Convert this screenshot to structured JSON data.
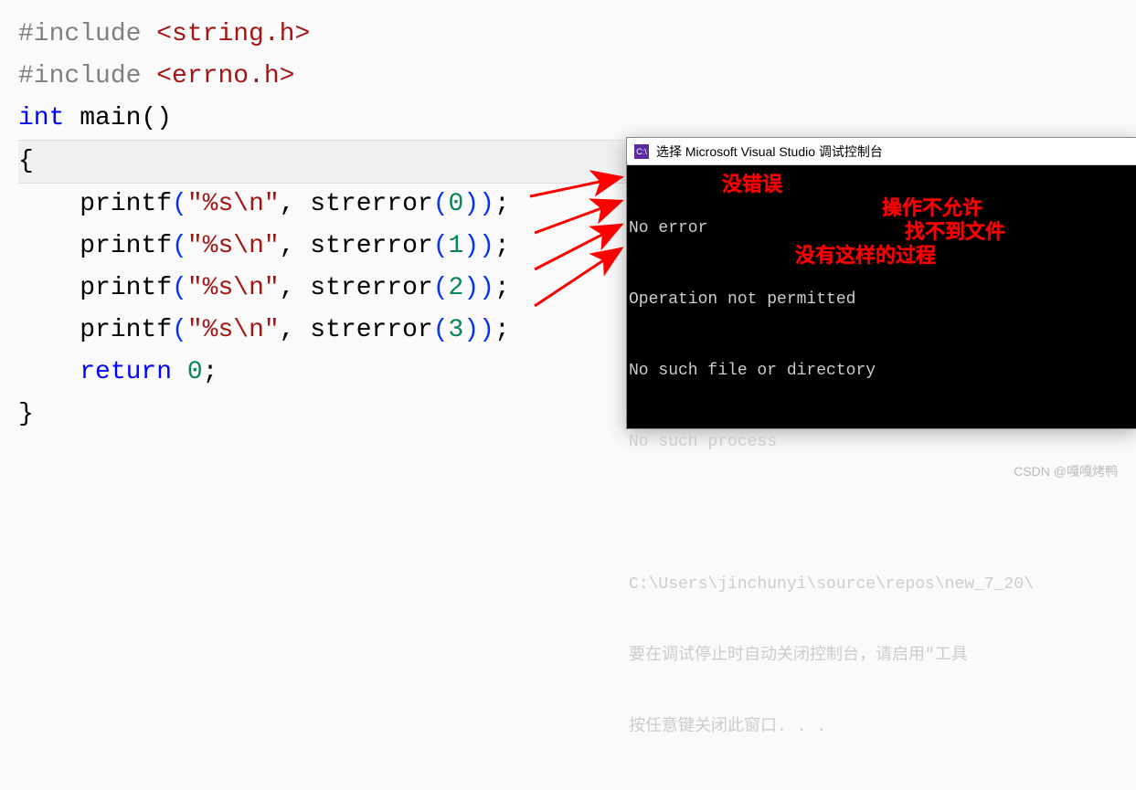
{
  "code": {
    "line1_pre": "#include ",
    "line1_path": "<string.h>",
    "line2_pre": "#include ",
    "line2_path": "<errno.h>",
    "line3_kw": "int",
    "line3_fn": " main()",
    "line4": "{",
    "printf_name": "printf",
    "printf_fmt": "\"%s\\n\"",
    "strerror_name": "strerror",
    "return_kw": "return",
    "semicolon": ";",
    "comma": ", ",
    "lparen": "(",
    "rparen": ")",
    "num0": "0",
    "num1": "1",
    "num2": "2",
    "num3": "3",
    "close_brace": "}"
  },
  "console": {
    "icon_text": "C:\\",
    "title": "选择 Microsoft Visual Studio 调试控制台",
    "out0": "No error",
    "out1": "Operation not permitted",
    "out2": "No such file or directory",
    "out3": "No such process",
    "path_line": "C:\\Users\\jinchunyi\\source\\repos\\new_7_20\\",
    "hint1": "要在调试停止时自动关闭控制台，请启用\"工具",
    "hint2": "按任意键关闭此窗口. . ."
  },
  "annotations": {
    "a0": "没错误",
    "a1": "操作不允许",
    "a2": "找不到文件",
    "a3": "没有这样的过程"
  },
  "watermark": "CSDN @嘎嘎烤鸭"
}
